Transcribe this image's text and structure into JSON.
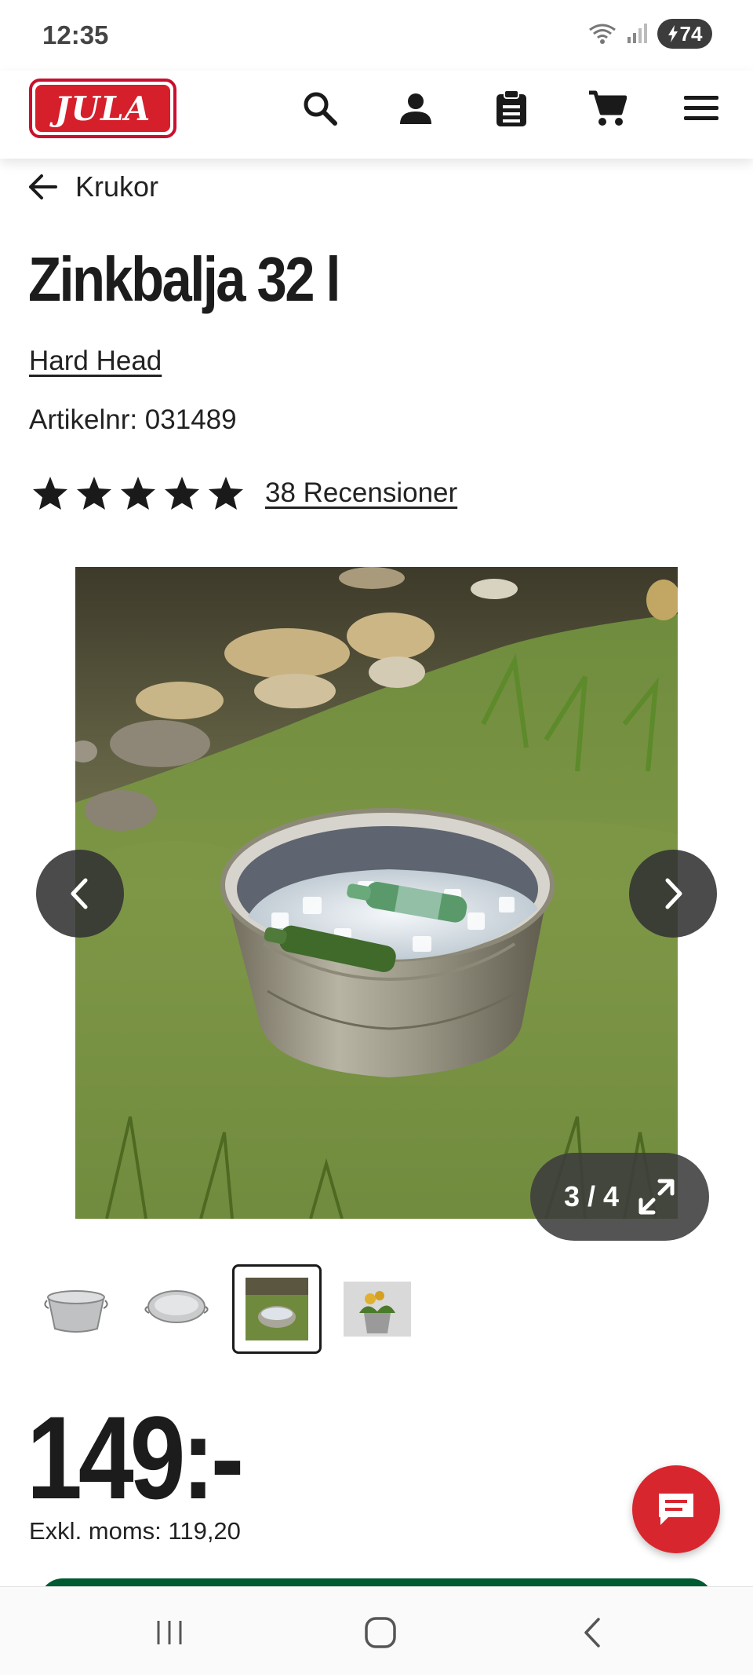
{
  "status_bar": {
    "time": "12:35",
    "battery": "74"
  },
  "header": {
    "logo_text": "JULA",
    "icons": [
      "search-icon",
      "account-icon",
      "list-icon",
      "cart-icon",
      "menu-icon"
    ]
  },
  "breadcrumb": {
    "back_label": "Krukor"
  },
  "product": {
    "title": "Zinkbalja 32 l",
    "brand": "Hard Head",
    "sku": "Artikelnr: 031489",
    "rating": 5,
    "rating_max": 5,
    "reviews_label": "38 Recensioner",
    "image_counter": "3 / 4",
    "thumbnails": [
      "thumb-bucket-side",
      "thumb-bucket-top",
      "thumb-bucket-grass",
      "thumb-bucket-flowers"
    ],
    "selected_thumbnail": 3,
    "price": "149:-",
    "price_ex_vat": "Exkl. moms: 119,20"
  },
  "colors": {
    "brand_red": "#d51f2b",
    "cart_green": "#005a32",
    "chat_red": "#d8262f"
  }
}
